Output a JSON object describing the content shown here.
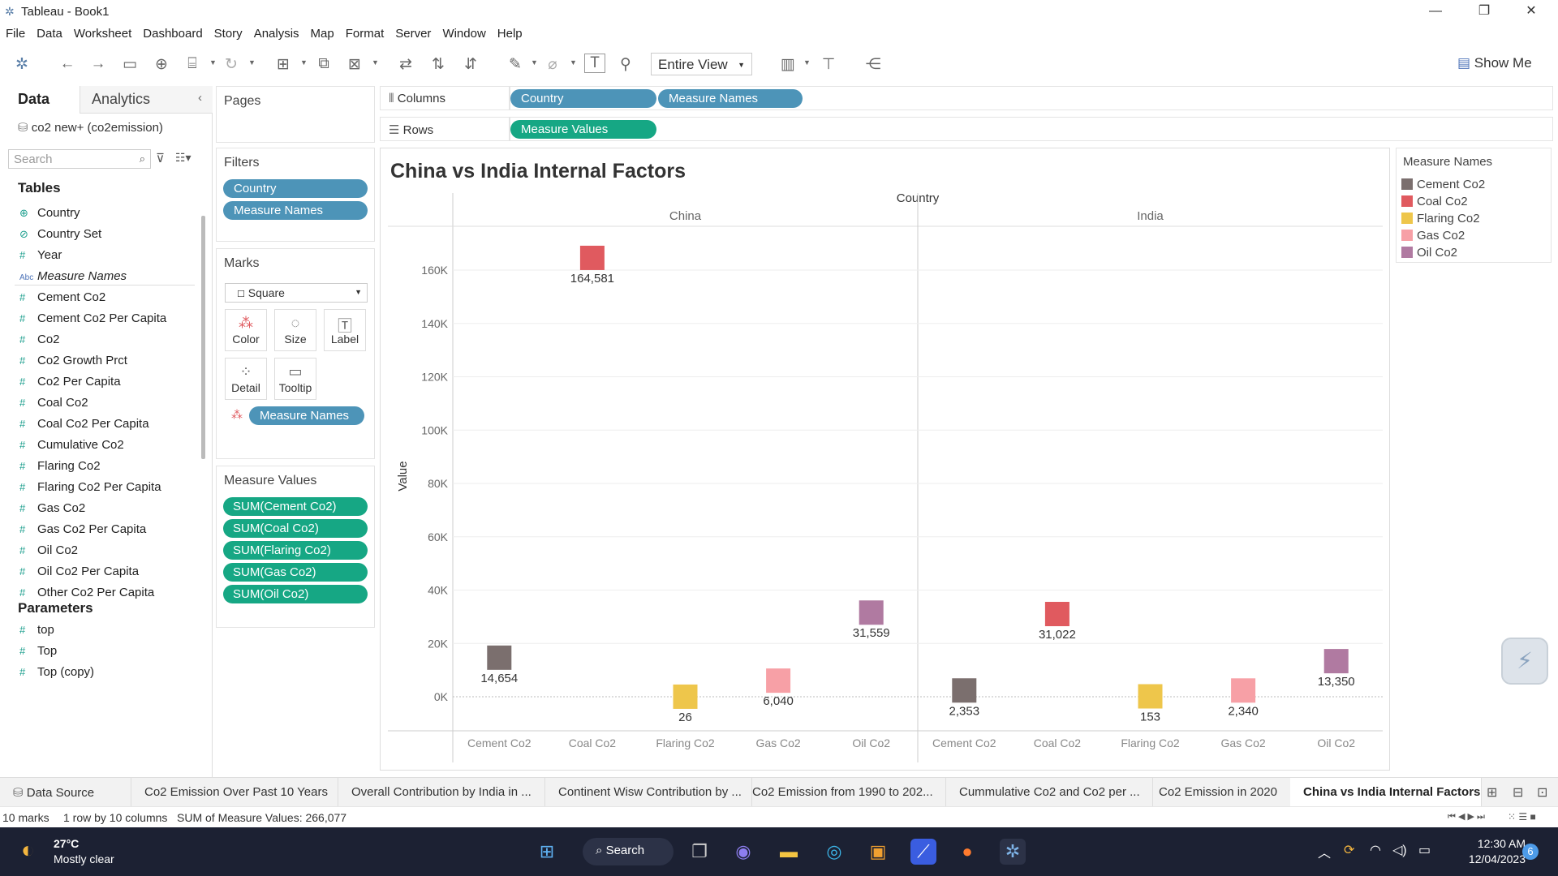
{
  "window": {
    "title": "Tableau - Book1"
  },
  "menu": [
    "File",
    "Data",
    "Worksheet",
    "Dashboard",
    "Story",
    "Analysis",
    "Map",
    "Format",
    "Server",
    "Window",
    "Help"
  ],
  "toolbar": {
    "fit": "Entire View",
    "show_me": "Show Me"
  },
  "datapane": {
    "tabs": [
      "Data",
      "Analytics"
    ],
    "source": "co2 new+ (co2emission)",
    "search_placeholder": "Search",
    "tables_label": "Tables",
    "fields": [
      {
        "icon": "globe",
        "name": "Country"
      },
      {
        "icon": "set",
        "name": "Country Set"
      },
      {
        "icon": "#",
        "name": "Year"
      },
      {
        "icon": "Abc",
        "name": "Measure Names"
      },
      {
        "icon": "#",
        "name": "Cement Co2"
      },
      {
        "icon": "#",
        "name": "Cement Co2 Per Capita"
      },
      {
        "icon": "#",
        "name": "Co2"
      },
      {
        "icon": "#",
        "name": "Co2 Growth Prct"
      },
      {
        "icon": "#",
        "name": "Co2 Per Capita"
      },
      {
        "icon": "#",
        "name": "Coal Co2"
      },
      {
        "icon": "#",
        "name": "Coal Co2 Per Capita"
      },
      {
        "icon": "#",
        "name": "Cumulative Co2"
      },
      {
        "icon": "#",
        "name": "Flaring Co2"
      },
      {
        "icon": "#",
        "name": "Flaring Co2 Per Capita"
      },
      {
        "icon": "#",
        "name": "Gas Co2"
      },
      {
        "icon": "#",
        "name": "Gas Co2 Per Capita"
      },
      {
        "icon": "#",
        "name": "Oil Co2"
      },
      {
        "icon": "#",
        "name": "Oil Co2 Per Capita"
      },
      {
        "icon": "#",
        "name": "Other Co2 Per Capita"
      }
    ],
    "parameters_label": "Parameters",
    "parameters": [
      "top",
      "Top",
      "Top (copy)"
    ]
  },
  "cards": {
    "pages": "Pages",
    "filters": "Filters",
    "filter_pills": [
      "Country",
      "Measure Names"
    ],
    "marks": "Marks",
    "mark_type": "Square",
    "mark_buttons": [
      "Color",
      "Size",
      "Label",
      "Detail",
      "Tooltip"
    ],
    "marks_pill": "Measure Names",
    "measure_values": "Measure Values",
    "measure_pills": [
      "SUM(Cement Co2)",
      "SUM(Coal Co2)",
      "SUM(Flaring Co2)",
      "SUM(Gas Co2)",
      "SUM(Oil Co2)"
    ]
  },
  "shelves": {
    "columns_label": "Columns",
    "rows_label": "Rows",
    "column_pills": [
      "Country",
      "Measure Names"
    ],
    "row_pills": [
      "Measure Values"
    ]
  },
  "legend": {
    "title": "Measure Names",
    "items": [
      {
        "name": "Cement Co2",
        "color": "#7b6f6e"
      },
      {
        "name": "Coal Co2",
        "color": "#e05a5f"
      },
      {
        "name": "Flaring Co2",
        "color": "#eec64b"
      },
      {
        "name": "Gas Co2",
        "color": "#f7a0a6"
      },
      {
        "name": "Oil Co2",
        "color": "#b07aa1"
      }
    ]
  },
  "chart_data": {
    "type": "scatter",
    "title": "China vs India Internal Factors",
    "header": "Country",
    "ylabel": "Value",
    "ylim": [
      -5000,
      170000
    ],
    "yticks": [
      0,
      20000,
      40000,
      60000,
      80000,
      100000,
      120000,
      140000,
      160000
    ],
    "ytick_labels": [
      "0K",
      "20K",
      "40K",
      "60K",
      "80K",
      "100K",
      "120K",
      "140K",
      "160K"
    ],
    "panels": [
      "China",
      "India"
    ],
    "categories": [
      "Cement Co2",
      "Coal Co2",
      "Flaring Co2",
      "Gas Co2",
      "Oil Co2"
    ],
    "series": [
      {
        "panel": "China",
        "values": [
          14654,
          164581,
          26,
          6040,
          31559
        ],
        "labels": [
          "14,654",
          "164,581",
          "26",
          "6,040",
          "31,559"
        ]
      },
      {
        "panel": "India",
        "values": [
          2353,
          31022,
          153,
          2340,
          13350
        ],
        "labels": [
          "2,353",
          "31,022",
          "153",
          "2,340",
          "13,350"
        ]
      }
    ]
  },
  "sheet_tabs": [
    "Data Source",
    "Co2 Emission Over Past 10 Years",
    "Overall Contribution by India in ...",
    "Continent Wisw Contribution by ...",
    "Co2 Emission from 1990 to 202...",
    "Cummulative Co2 and Co2 per ...",
    "Co2 Emission in 2020",
    "China vs India Internal Factors"
  ],
  "status": {
    "marks": "10 marks",
    "dims": "1 row by 10 columns",
    "sum": "SUM of Measure Values: 266,077"
  },
  "taskbar": {
    "weather_temp": "27°C",
    "weather_desc": "Mostly clear",
    "search": "Search",
    "time": "12:30 AM",
    "date": "12/04/2023",
    "badge": "6"
  }
}
